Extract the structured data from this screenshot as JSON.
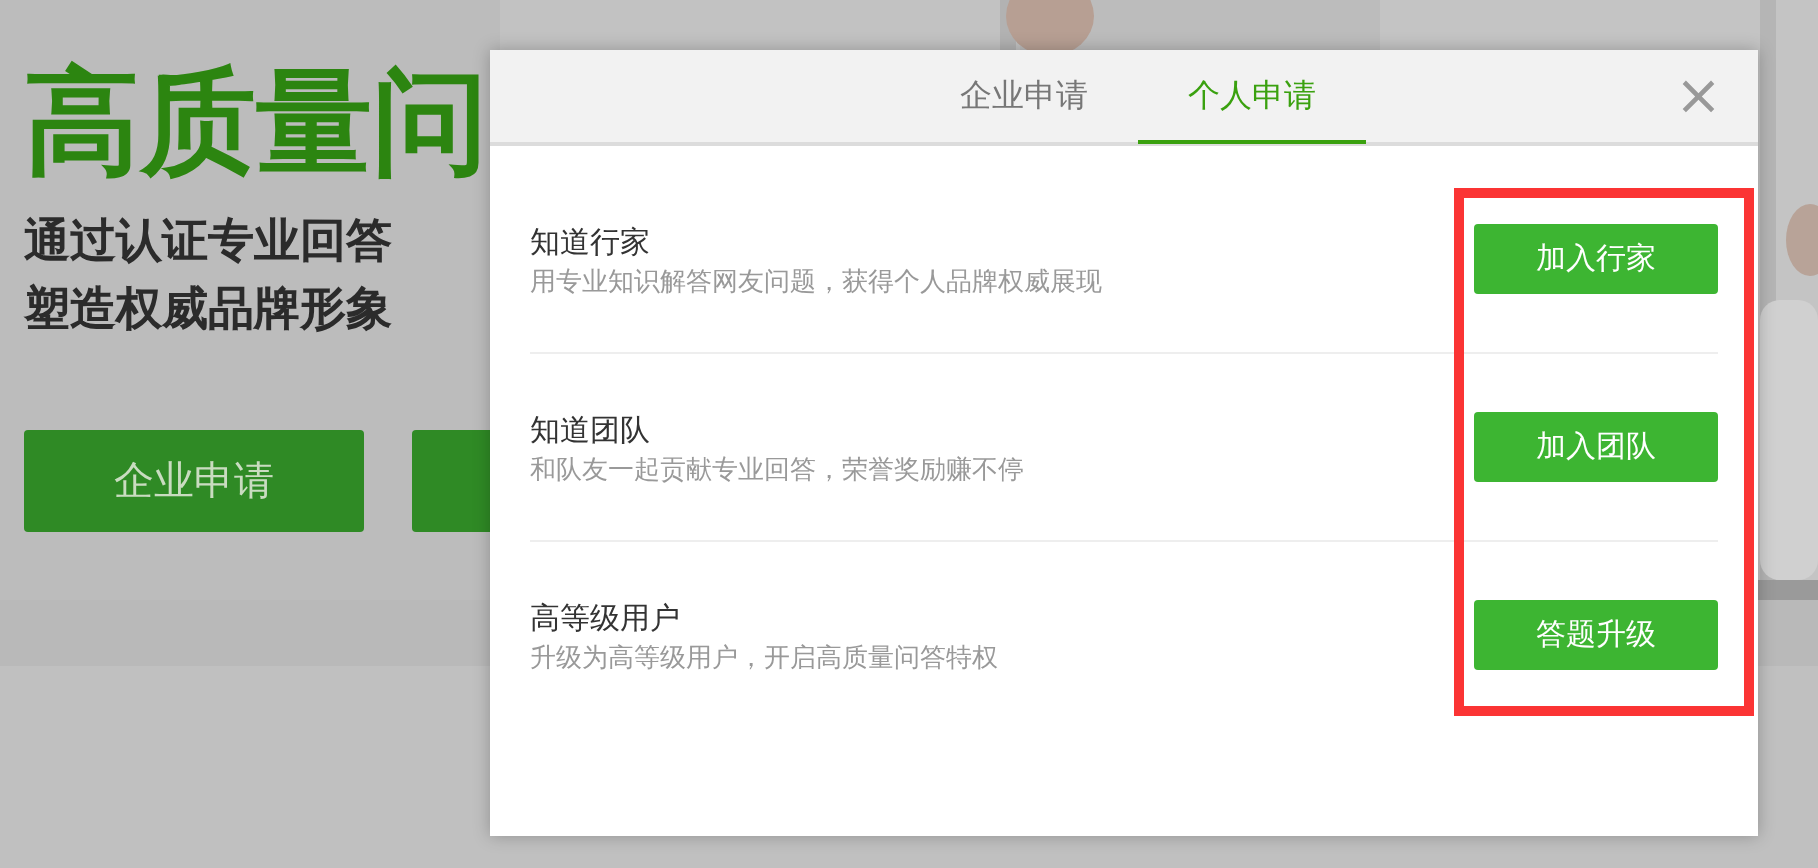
{
  "background_page": {
    "headline": "高质量问",
    "taglines": [
      "通过认证专业回答",
      "塑造权威品牌形象"
    ],
    "buttons": [
      {
        "kind": "labeled",
        "label": "企业申请"
      },
      {
        "kind": "covered"
      }
    ]
  },
  "dialog": {
    "tabs": [
      {
        "label": "企业申请",
        "selected": false
      },
      {
        "label": "个人申请",
        "selected": true
      }
    ],
    "close": "×",
    "items": [
      {
        "title": "知道行家",
        "description": "用专业知识解答网友问题，获得个人品牌权威展现",
        "action": "加入行家"
      },
      {
        "title": "知道团队",
        "description": "和队友一起贡献专业回答，荣誉奖励赚不停",
        "action": "加入团队"
      },
      {
        "title": "高等级用户",
        "description": "升级为高等级用户，开启高质量问答特权",
        "action": "答题升级"
      }
    ],
    "annotation": {
      "kind": "frame"
    }
  }
}
